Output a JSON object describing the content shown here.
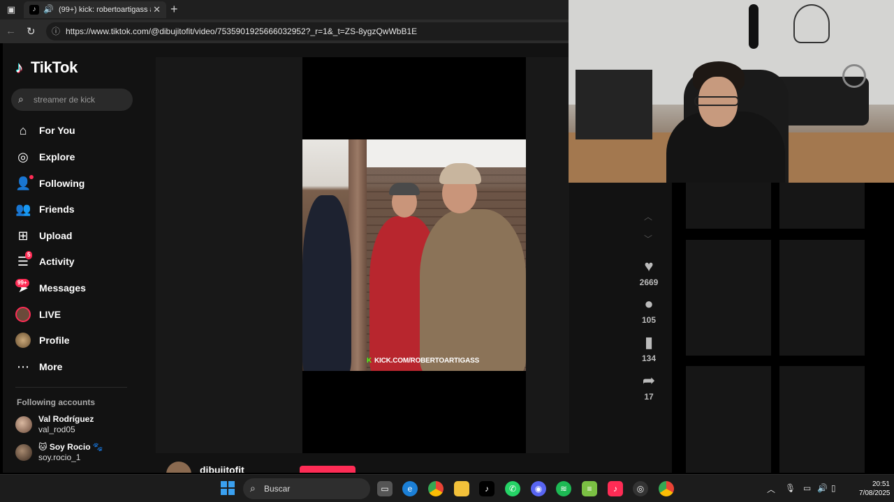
{
  "browser": {
    "tab_title": "(99+) kick: robertoartigass #...",
    "new_tab_symbol": "+",
    "url": "https://www.tiktok.com/@dibujitofit/video/7535901925666032952?_r=1&_t=ZS-8ygzQwWbB1E"
  },
  "tiktok": {
    "logo_text": "TikTok",
    "search_placeholder": "streamer de kick",
    "nav": [
      {
        "label": "For You",
        "icon": "home-icon"
      },
      {
        "label": "Explore",
        "icon": "compass-icon"
      },
      {
        "label": "Following",
        "icon": "user-follow-icon"
      },
      {
        "label": "Friends",
        "icon": "friends-icon"
      },
      {
        "label": "Upload",
        "icon": "plus-square-icon"
      },
      {
        "label": "Activity",
        "icon": "inbox-icon",
        "badge": "5"
      },
      {
        "label": "Messages",
        "icon": "paper-plane-icon",
        "badge": "99+"
      },
      {
        "label": "LIVE",
        "icon": "live-icon"
      },
      {
        "label": "Profile",
        "icon": "avatar-icon"
      },
      {
        "label": "More",
        "icon": "more-dots-icon"
      }
    ],
    "following_title": "Following accounts",
    "accounts": [
      {
        "name": "Val Rodríguez",
        "username": "val_rod05"
      },
      {
        "name": "🐱 Soy Rocio 🐾",
        "username": "soy.rocio_1"
      }
    ],
    "video": {
      "watermark": "KICK.COM/ROBERTOARTIGASS",
      "author": "dibujitofit",
      "likes": "2669",
      "comments": "105",
      "saves": "134",
      "shares": "17"
    }
  },
  "taskbar": {
    "search_label": "Buscar",
    "time": "20:51",
    "date": "7/08/2025"
  },
  "colors": {
    "accent": "#fe2c55",
    "kick_green": "#53fc18",
    "windows_blue": "#3aa0f0"
  }
}
